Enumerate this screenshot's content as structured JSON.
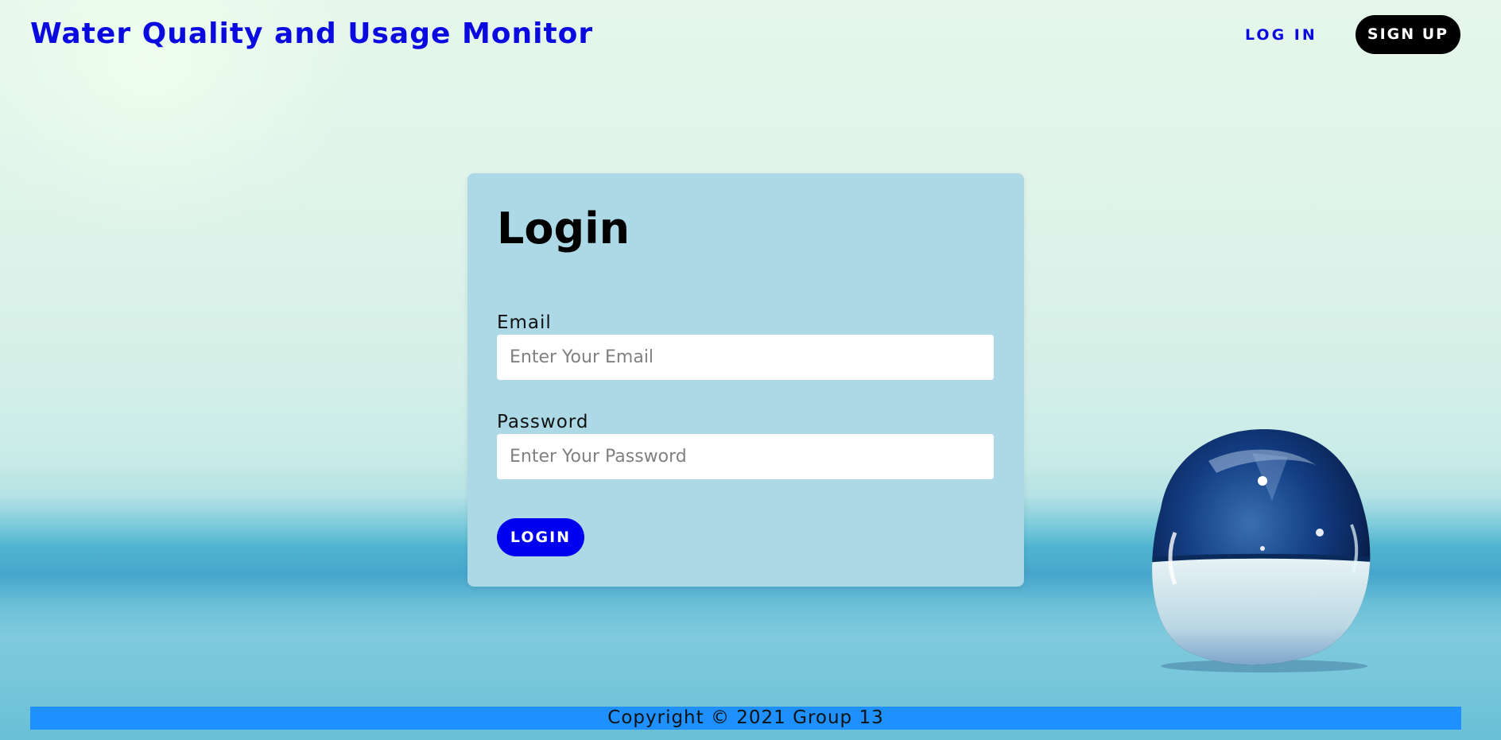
{
  "header": {
    "brand": "Water Quality and Usage Monitor",
    "nav_login": "LOG IN",
    "nav_signup": "SIGN UP"
  },
  "login_form": {
    "title": "Login",
    "email_label": "Email",
    "email_placeholder": "Enter Your Email",
    "password_label": "Password",
    "password_placeholder": "Enter Your Password",
    "submit_label": "LOGIN"
  },
  "footer": {
    "copyright": "Copyright © 2021 Group 13"
  },
  "colors": {
    "brand": "#0a0ae0",
    "card_background": "#add8e6",
    "login_button": "#0000f0",
    "signup_button": "#000000",
    "footer_bar": "#1e90ff"
  }
}
